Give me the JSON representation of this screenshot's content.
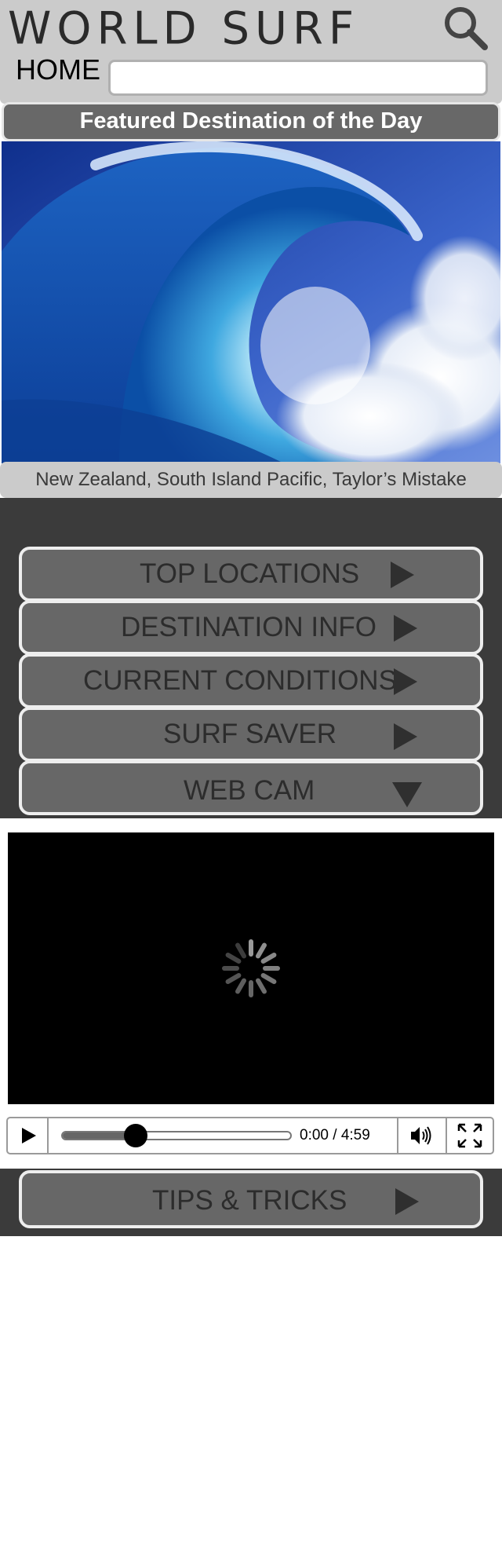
{
  "header": {
    "logo": "WORLD SURF",
    "home_label": "HOME",
    "search_value": ""
  },
  "featured": {
    "title": "Featured Destination of the Day",
    "caption": "New Zealand, South Island Pacific, Taylor’s Mistake"
  },
  "menu": [
    {
      "label": "TOP LOCATIONS",
      "icon": "arrow-right-icon"
    },
    {
      "label": "DESTINATION INFO",
      "icon": "arrow-right-icon"
    },
    {
      "label": "CURRENT CONDITIONS",
      "icon": "arrow-right-icon"
    },
    {
      "label": "SURF SAVER",
      "icon": "arrow-right-icon"
    },
    {
      "label": "WEB CAM",
      "icon": "arrow-down-icon"
    }
  ],
  "video": {
    "time_display": "0:00 / 4:59",
    "progress": 0.32,
    "state": "loading"
  },
  "tips": {
    "label": "TIPS & TRICKS",
    "icon": "arrow-right-icon"
  },
  "colors": {
    "header_bg": "#cbcbcb",
    "bar_bg": "#686868",
    "dark_bg": "#3b3b3b",
    "button_bg": "#676767",
    "button_border": "#eeeeee"
  }
}
